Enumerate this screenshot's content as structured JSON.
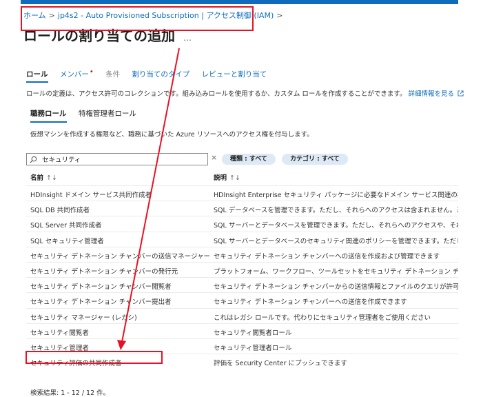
{
  "breadcrumb": {
    "home": "ホーム",
    "sub": "jp4s2 - Auto Provisioned Subscription | アクセス制御 (IAM)",
    "sep": ">"
  },
  "page": {
    "title": "ロールの割り当ての追加",
    "more": "…"
  },
  "tabs": [
    {
      "label": "ロール",
      "state": "active"
    },
    {
      "label": "メンバー",
      "state": "link",
      "required_dot": "•"
    },
    {
      "label": "条件",
      "state": "disabled"
    },
    {
      "label": "割り当てのタイプ",
      "state": "link"
    },
    {
      "label": "レビューと割り当て",
      "state": "link"
    }
  ],
  "description": {
    "text": "ロールの定義は、アクセス許可のコレクションです。組み込みロールを使用するか、カスタム ロールを作成することができます。",
    "link": "詳細情報を見る",
    "link_icon": "external-link-icon"
  },
  "subtabs": [
    {
      "label": "職務ロール",
      "active": true
    },
    {
      "label": "特権管理者ロール",
      "active": false
    }
  ],
  "subtab_description": "仮想マシンを作成する権限など、職務に基づいた Azure リソースへのアクセス権を付与します。",
  "search": {
    "value": "セキュリティ",
    "clear": "×",
    "icon": "search-icon"
  },
  "filters": {
    "type": "種類 : すべて",
    "category": "カテゴリ : すべて"
  },
  "table": {
    "columns": [
      {
        "label": "名前",
        "sort": "↑↓"
      },
      {
        "label": "説明",
        "sort": "↑↓"
      }
    ],
    "rows": [
      {
        "name": "HDInsight ドメイン サービス共同作成者",
        "desc": "HDInsight Enterprise セキュリティ パッケージに必要なドメイン サービス関連の操作の読み取"
      },
      {
        "name": "SQL DB 共同作成者",
        "desc": "SQL データベースを管理できます。ただし、それらへのアクセスは含まれません。また、SQL データベ"
      },
      {
        "name": "SQL Server 共同作成者",
        "desc": "SQL サーバーとデータベースを管理できます。ただし、それらへのアクセスや、それらのセキュリティ関連"
      },
      {
        "name": "SQL セキュリティ管理者",
        "desc": "SQL サーバーとデータベースのセキュリティ関連のポリシーを管理できます。ただし、それらへのアクセ"
      },
      {
        "name": "セキュリティ デトネーション チャンバーの送信マネージャー",
        "desc": "セキュリティ デトネーション チャンバーへの送信を作成および管理できます"
      },
      {
        "name": "セキュリティ デトネーション チャンバーの発行元",
        "desc": "プラットフォーム、ワークフロー、ツールセットをセキュリティ デトネーション チャンバーに公開および変更"
      },
      {
        "name": "セキュリティ デトネーション チャンバー閲覧者",
        "desc": "セキュリティ デトネーション チャンバーからの送信情報とファイルのクエリが許可されます"
      },
      {
        "name": "セキュリティ デトネーション チャンバー提出者",
        "desc": "セキュリティ デトネーション チャンバーへの送信を作成できます"
      },
      {
        "name": "セキュリティ マネージャー (レガシ)",
        "desc": "これはレガシ ロールです。代わりにセキュリティ管理者をご使用ください"
      },
      {
        "name": "セキュリティ閲覧者",
        "desc": "セキュリティ閲覧者ロール"
      },
      {
        "name": "セキュリティ管理者",
        "desc": "セキュリティ管理者ロール"
      },
      {
        "name": "セキュリティ評価の共同作成者",
        "desc": "評価を Security Center にプッシュできます"
      }
    ]
  },
  "footer": "検索結果: 1 - 12 / 12 件。",
  "colors": {
    "accent": "#0f6cbd",
    "annotation": "#e81123",
    "pill_bg": "#dde9f5"
  }
}
